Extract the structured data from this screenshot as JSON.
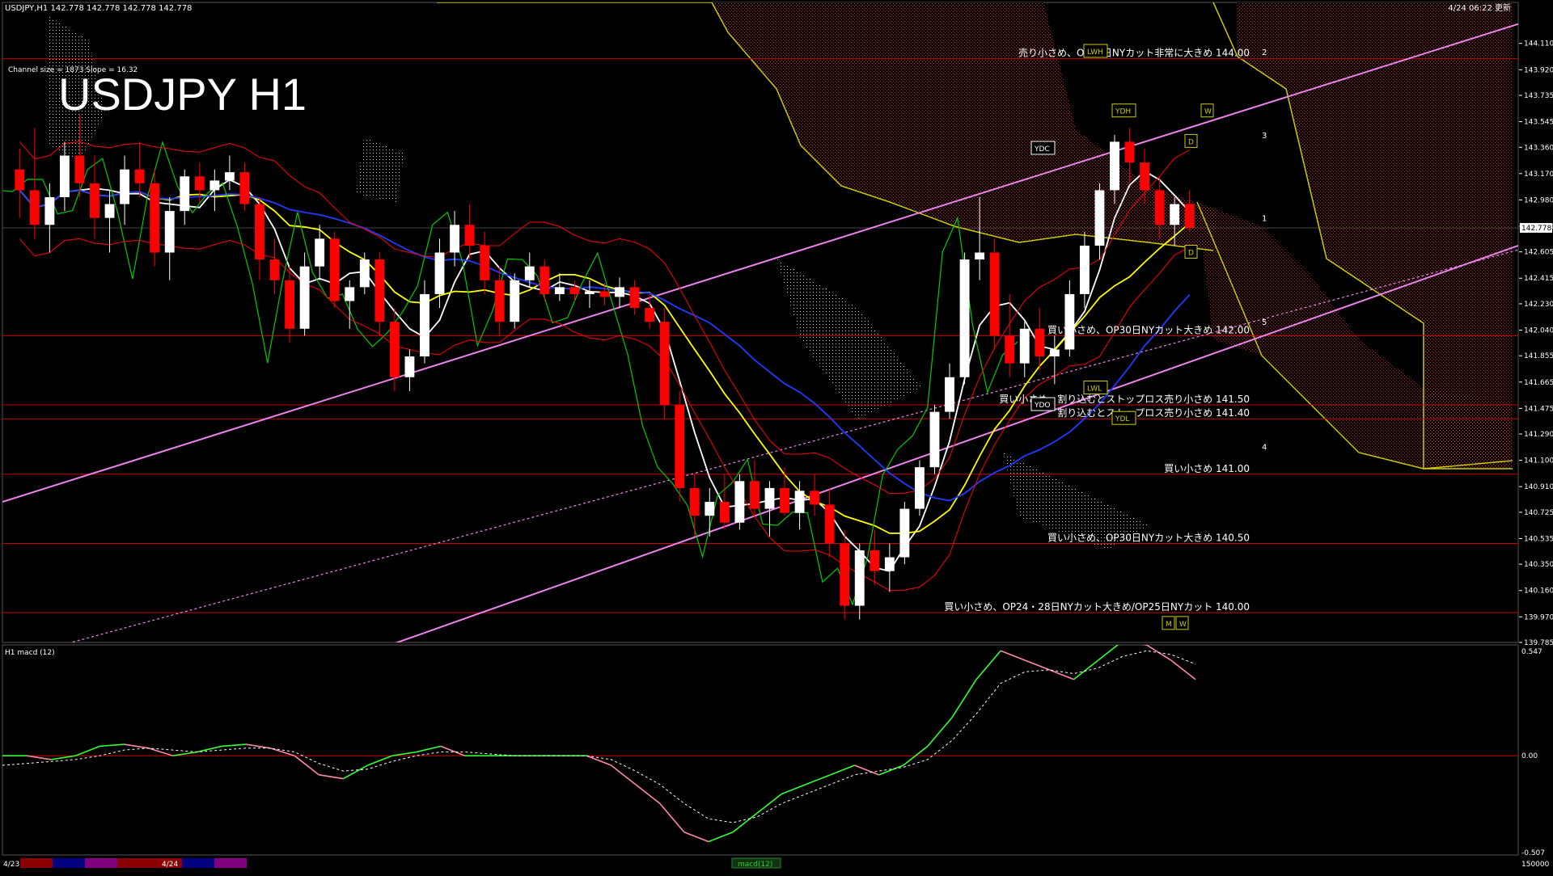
{
  "header": {
    "symbol_line": "USDJPY,H1  142.778 142.778 142.778 142.778",
    "timestamp": "4/24 06:22 更新",
    "channel_info": "Channel size = 1873 Slope = 16.32",
    "big_title": "USDJPY H1"
  },
  "colors": {
    "background": "#000000",
    "bull_candle": "#ffffff",
    "bear_candle": "#ff0000",
    "channel": "#ee82ee",
    "ma_white": "#ffffff",
    "ma_yellow": "#ffff00",
    "ma_blue": "#1e3cff",
    "chikou": "#00cc00",
    "cloud": "#ff3030",
    "level_line": "#cc0000",
    "macd_up": "#33ff33",
    "macd_down": "#ff88aa"
  },
  "chart_data": [
    {
      "type": "line",
      "title": "USDJPY H1",
      "ylim": [
        139.785,
        144.19
      ],
      "price_ticks": [
        "144.110",
        "143.920",
        "143.735",
        "143.545",
        "143.360",
        "143.170",
        "142.980",
        "142.790",
        "142.605",
        "142.415",
        "142.230",
        "142.040",
        "141.855",
        "141.665",
        "141.475",
        "141.290",
        "141.100",
        "140.910",
        "140.725",
        "140.535",
        "140.350",
        "140.160",
        "139.970",
        "139.785"
      ],
      "current_price": "142.778",
      "candles": [
        [
          143.2,
          143.35,
          142.85,
          143.05
        ],
        [
          143.05,
          143.5,
          142.7,
          142.8
        ],
        [
          142.8,
          143.1,
          142.6,
          143.0
        ],
        [
          143.0,
          143.4,
          142.9,
          143.3
        ],
        [
          143.3,
          143.6,
          143.0,
          143.1
        ],
        [
          143.1,
          143.3,
          142.7,
          142.85
        ],
        [
          142.85,
          143.05,
          142.6,
          142.95
        ],
        [
          142.95,
          143.3,
          142.8,
          143.2
        ],
        [
          143.2,
          143.4,
          143.0,
          143.1
        ],
        [
          143.1,
          143.2,
          142.5,
          142.6
        ],
        [
          142.6,
          143.0,
          142.4,
          142.9
        ],
        [
          142.9,
          143.2,
          142.8,
          143.15
        ],
        [
          143.15,
          143.25,
          142.95,
          143.05
        ],
        [
          143.05,
          143.2,
          142.9,
          143.12
        ],
        [
          143.12,
          143.3,
          143.05,
          143.18
        ],
        [
          143.18,
          143.25,
          142.9,
          142.95
        ],
        [
          142.95,
          143.0,
          142.4,
          142.55
        ],
        [
          142.55,
          142.7,
          142.3,
          142.4
        ],
        [
          142.4,
          142.5,
          141.95,
          142.05
        ],
        [
          142.05,
          142.6,
          142.0,
          142.5
        ],
        [
          142.5,
          142.8,
          142.4,
          142.7
        ],
        [
          142.7,
          142.75,
          142.2,
          142.25
        ],
        [
          142.25,
          142.4,
          142.05,
          142.35
        ],
        [
          142.35,
          142.6,
          142.3,
          142.55
        ],
        [
          142.55,
          142.6,
          142.0,
          142.1
        ],
        [
          142.1,
          142.2,
          141.6,
          141.7
        ],
        [
          141.7,
          141.9,
          141.6,
          141.85
        ],
        [
          141.85,
          142.4,
          141.8,
          142.3
        ],
        [
          142.3,
          142.7,
          142.2,
          142.6
        ],
        [
          142.6,
          142.9,
          142.5,
          142.8
        ],
        [
          142.8,
          142.95,
          142.55,
          142.65
        ],
        [
          142.65,
          142.75,
          142.3,
          142.4
        ],
        [
          142.4,
          142.5,
          142.0,
          142.1
        ],
        [
          142.1,
          142.45,
          142.05,
          142.4
        ],
        [
          142.4,
          142.6,
          142.35,
          142.5
        ],
        [
          142.5,
          142.55,
          142.25,
          142.3
        ],
        [
          142.3,
          142.45,
          142.25,
          142.35
        ],
        [
          142.35,
          142.4,
          142.25,
          142.3
        ],
        [
          142.3,
          142.4,
          142.2,
          142.32
        ],
        [
          142.32,
          142.38,
          142.22,
          142.28
        ],
        [
          142.28,
          142.42,
          142.2,
          142.35
        ],
        [
          142.35,
          142.4,
          142.15,
          142.2
        ],
        [
          142.2,
          142.3,
          142.05,
          142.1
        ],
        [
          142.1,
          142.2,
          141.4,
          141.5
        ],
        [
          141.5,
          141.6,
          140.8,
          140.9
        ],
        [
          140.9,
          141.0,
          140.55,
          140.7
        ],
        [
          140.7,
          140.9,
          140.55,
          140.8
        ],
        [
          140.8,
          141.0,
          140.6,
          140.65
        ],
        [
          140.65,
          141.0,
          140.6,
          140.95
        ],
        [
          140.95,
          141.1,
          140.7,
          140.75
        ],
        [
          140.75,
          140.95,
          140.55,
          140.9
        ],
        [
          140.9,
          141.05,
          140.7,
          140.72
        ],
        [
          140.72,
          140.95,
          140.6,
          140.88
        ],
        [
          140.88,
          141.0,
          140.7,
          140.78
        ],
        [
          140.78,
          140.9,
          140.4,
          140.5
        ],
        [
          140.5,
          140.6,
          139.95,
          140.05
        ],
        [
          140.05,
          140.5,
          139.95,
          140.45
        ],
        [
          140.45,
          140.6,
          140.2,
          140.3
        ],
        [
          140.3,
          140.5,
          140.15,
          140.4
        ],
        [
          140.4,
          140.8,
          140.35,
          140.75
        ],
        [
          140.75,
          141.1,
          140.7,
          141.05
        ],
        [
          141.05,
          141.5,
          141.0,
          141.45
        ],
        [
          141.45,
          141.8,
          141.4,
          141.7
        ],
        [
          141.7,
          142.6,
          141.65,
          142.55
        ],
        [
          142.55,
          143.0,
          142.4,
          142.6
        ],
        [
          142.6,
          142.7,
          141.9,
          142.0
        ],
        [
          142.0,
          142.3,
          141.7,
          141.8
        ],
        [
          141.8,
          142.1,
          141.7,
          142.05
        ],
        [
          142.05,
          142.2,
          141.75,
          141.85
        ],
        [
          141.85,
          142.0,
          141.65,
          141.9
        ],
        [
          141.9,
          142.4,
          141.85,
          142.3
        ],
        [
          142.3,
          142.75,
          142.2,
          142.65
        ],
        [
          142.65,
          143.1,
          142.55,
          143.05
        ],
        [
          143.05,
          143.45,
          142.95,
          143.4
        ],
        [
          143.4,
          143.5,
          143.1,
          143.25
        ],
        [
          143.25,
          143.35,
          142.95,
          143.05
        ],
        [
          143.05,
          143.15,
          142.7,
          142.8
        ],
        [
          142.8,
          143.0,
          142.65,
          142.95
        ],
        [
          142.95,
          143.05,
          142.75,
          142.778
        ]
      ],
      "channel_labels": [
        "2",
        "3",
        "1",
        "5",
        "4"
      ],
      "level_lines": [
        {
          "price": 144.0,
          "label": "売り小さめ、OP24日NYカット非常に大きめ 144.00"
        },
        {
          "price": 142.0,
          "label": "買い小さめ、OP30日NYカット大きめ 142.00"
        },
        {
          "price": 141.5,
          "label": "買い小さめ、割り込むとストップロス売り小さめ 141.50"
        },
        {
          "price": 141.4,
          "label": "割り込むとストップロス売り小さめ 141.40"
        },
        {
          "price": 141.0,
          "label": "買い小さめ 141.00"
        },
        {
          "price": 140.5,
          "label": "買い小さめ、OP30日NYカット大きめ 140.50"
        },
        {
          "price": 140.0,
          "label": "買い小さめ、OP24・28日NYカット大きめ/OP25日NYカット 140.00"
        }
      ],
      "box_labels": [
        "LWH",
        "YDH",
        "YDC",
        "W",
        "D",
        "D",
        "YDO",
        "LWL",
        "YDL",
        "M",
        "W"
      ]
    },
    {
      "type": "line",
      "title": "H1  macd (12)",
      "ylim": [
        -0.507,
        0.547
      ],
      "ticks": [
        "0.547",
        "0.00",
        "-0.507"
      ],
      "series": [
        {
          "values": [
            0.0,
            0.0,
            -0.02,
            0.0,
            0.05,
            0.06,
            0.04,
            0.0,
            0.02,
            0.05,
            0.06,
            0.04,
            0.0,
            -0.1,
            -0.12,
            -0.05,
            0.0,
            0.02,
            0.05,
            0.0,
            0.0,
            0.0,
            0.0,
            0.0,
            0.0,
            -0.05,
            -0.15,
            -0.25,
            -0.4,
            -0.45,
            -0.4,
            -0.3,
            -0.2,
            -0.15,
            -0.1,
            -0.05,
            -0.1,
            -0.05,
            0.05,
            0.2,
            0.4,
            0.55,
            0.5,
            0.45,
            0.4,
            0.5,
            0.6,
            0.58,
            0.5,
            0.4
          ]
        },
        {
          "values": [
            -0.05,
            -0.04,
            -0.03,
            -0.02,
            0.0,
            0.03,
            0.04,
            0.03,
            0.02,
            0.03,
            0.04,
            0.04,
            0.02,
            -0.04,
            -0.08,
            -0.07,
            -0.03,
            0.0,
            0.02,
            0.02,
            0.01,
            0.0,
            0.0,
            0.0,
            0.0,
            -0.02,
            -0.08,
            -0.15,
            -0.25,
            -0.33,
            -0.35,
            -0.32,
            -0.25,
            -0.2,
            -0.15,
            -0.1,
            -0.08,
            -0.06,
            -0.02,
            0.08,
            0.22,
            0.38,
            0.44,
            0.45,
            0.43,
            0.46,
            0.52,
            0.55,
            0.53,
            0.48
          ]
        }
      ]
    }
  ],
  "footer": {
    "date_labels": [
      "4/23",
      "4/24"
    ],
    "bottom_value": "150000",
    "macd_badge": "macd(12)"
  }
}
